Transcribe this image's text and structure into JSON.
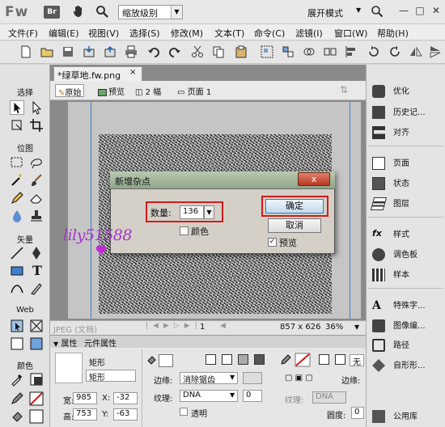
{
  "titlebar": {
    "app_logo": "Fw",
    "br_label": "Br",
    "zoom_select": "缩放级别",
    "workspace_mode": "展开模式",
    "minimize": "—",
    "maximize": "□",
    "close": "✕"
  },
  "menubar": {
    "items": [
      "文件(F)",
      "编辑(E)",
      "视图(V)",
      "选择(S)",
      "修改(M)",
      "文本(T)",
      "命令(C)",
      "滤镜(I)",
      "窗口(W)",
      "帮助(H)"
    ]
  },
  "document": {
    "tab_title": "*绿草地.fw.png",
    "tab_close": "×",
    "view_original": "原始",
    "view_preview": "预览",
    "view_2up": "2 幅",
    "page_label": "页面 1"
  },
  "tools": {
    "select_label": "选择",
    "bitmap_label": "位图",
    "vector_label": "矢量",
    "web_label": "Web",
    "color_label": "颜色"
  },
  "status": {
    "format": "JPEG (文档)",
    "page_number": "1",
    "canvas_size": "857 x 626",
    "zoom": "36%"
  },
  "properties": {
    "tab_props": "属性",
    "tab_symbol": "元件属性",
    "object_type": "矩形",
    "object_name": "矩形",
    "width_label": "宽:",
    "width_value": "985",
    "height_label": "高:",
    "height_value": "753",
    "x_label": "X:",
    "x_value": "-32",
    "y_label": "Y:",
    "y_value": "-63",
    "edge_label": "边缘:",
    "edge_value": "消除锯齿",
    "texture_label": "纹理:",
    "texture_value": "DNA",
    "texture_pct": "0",
    "transparent_label": "透明",
    "edge_label_2": "边缘:",
    "texture_label_2": "纹理:",
    "texture_value_2": "DNA",
    "roundness_label": "圆度:",
    "roundness_value": "0",
    "none_label": "无"
  },
  "right_panel": {
    "items": [
      "优化",
      "历史记...",
      "对齐",
      "页面",
      "状态",
      "图层",
      "样式",
      "调色板",
      "样本",
      "特殊字...",
      "图像编...",
      "路径",
      "自形形...",
      "公用库"
    ]
  },
  "dialog": {
    "title": "新增杂点",
    "close": "x",
    "amount_label": "数量:",
    "amount_value": "136",
    "color_label": "颜色",
    "ok_label": "确定",
    "cancel_label": "取消",
    "preview_label": "预览",
    "preview_checked": "✓"
  },
  "watermark": {
    "text": "lily51588"
  }
}
